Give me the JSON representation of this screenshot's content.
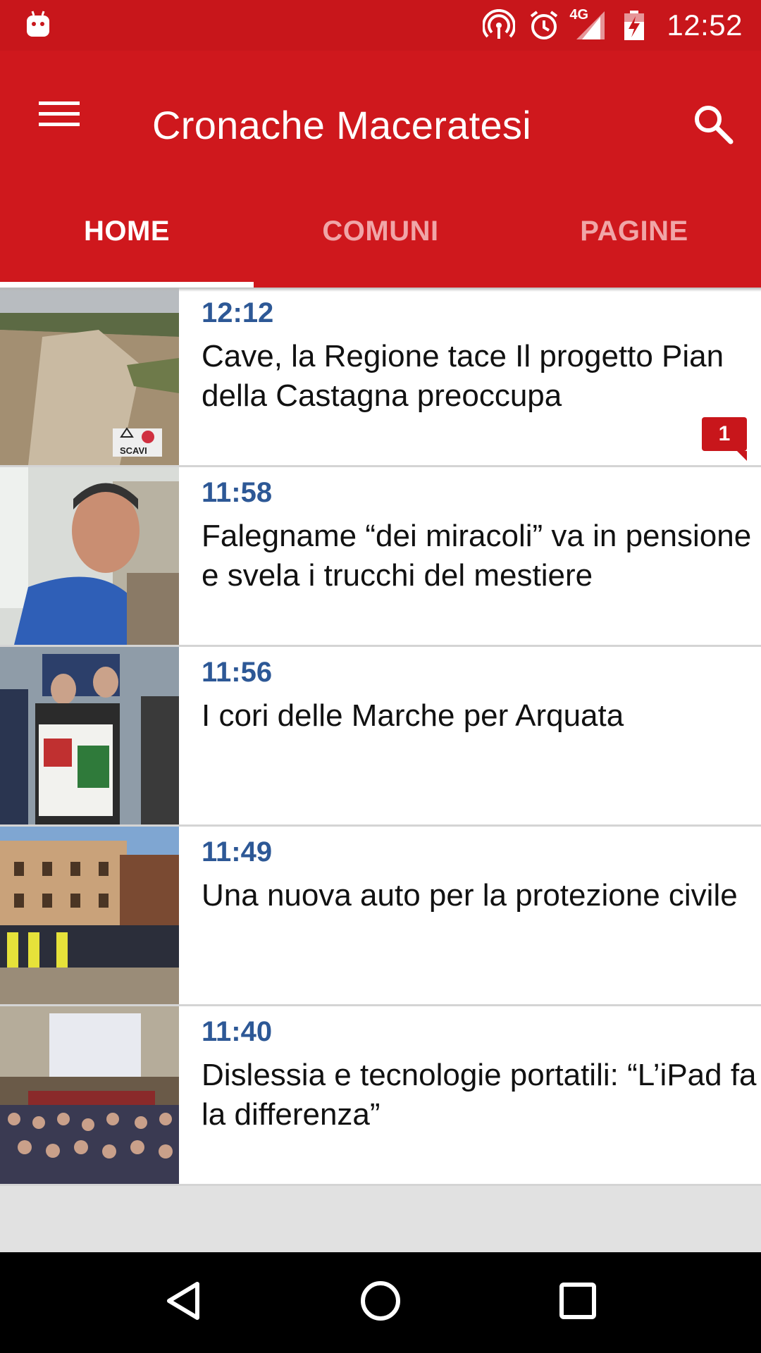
{
  "status_bar": {
    "time": "12:52",
    "network_label": "4G",
    "icons": [
      "android-debug-icon",
      "hotspot-icon",
      "alarm-icon",
      "signal-icon",
      "battery-charging-icon"
    ]
  },
  "app_bar": {
    "title": "Cronache Maceratesi",
    "menu_icon": "hamburger-menu-icon",
    "search_icon": "search-icon",
    "background_color": "#cf181d"
  },
  "tabs": [
    {
      "label": "HOME",
      "active": true
    },
    {
      "label": "COMUNI",
      "active": false
    },
    {
      "label": "PAGINE",
      "active": false
    }
  ],
  "news": [
    {
      "time": "12:12",
      "title": "Cave, la Regione tace Il progetto Pian della Castagna preoccupa",
      "comments": "1",
      "thumb_sign_text": "SCAVI"
    },
    {
      "time": "11:58",
      "title": "Falegname “dei miracoli” va in pensione e svela i trucchi del mestiere"
    },
    {
      "time": "11:56",
      "title": "I cori delle Marche per Arquata"
    },
    {
      "time": "11:49",
      "title": "Una nuova auto per la protezione civile"
    },
    {
      "time": "11:40",
      "title": "Dislessia e tecnologie portatili: “L’iPad fa la differenza”"
    }
  ],
  "nav_bar": {
    "buttons": [
      "back-icon",
      "home-icon",
      "recents-icon"
    ]
  },
  "colors": {
    "accent": "#c8161b",
    "time_text": "#2d5896",
    "divider": "#d4d4d4"
  }
}
